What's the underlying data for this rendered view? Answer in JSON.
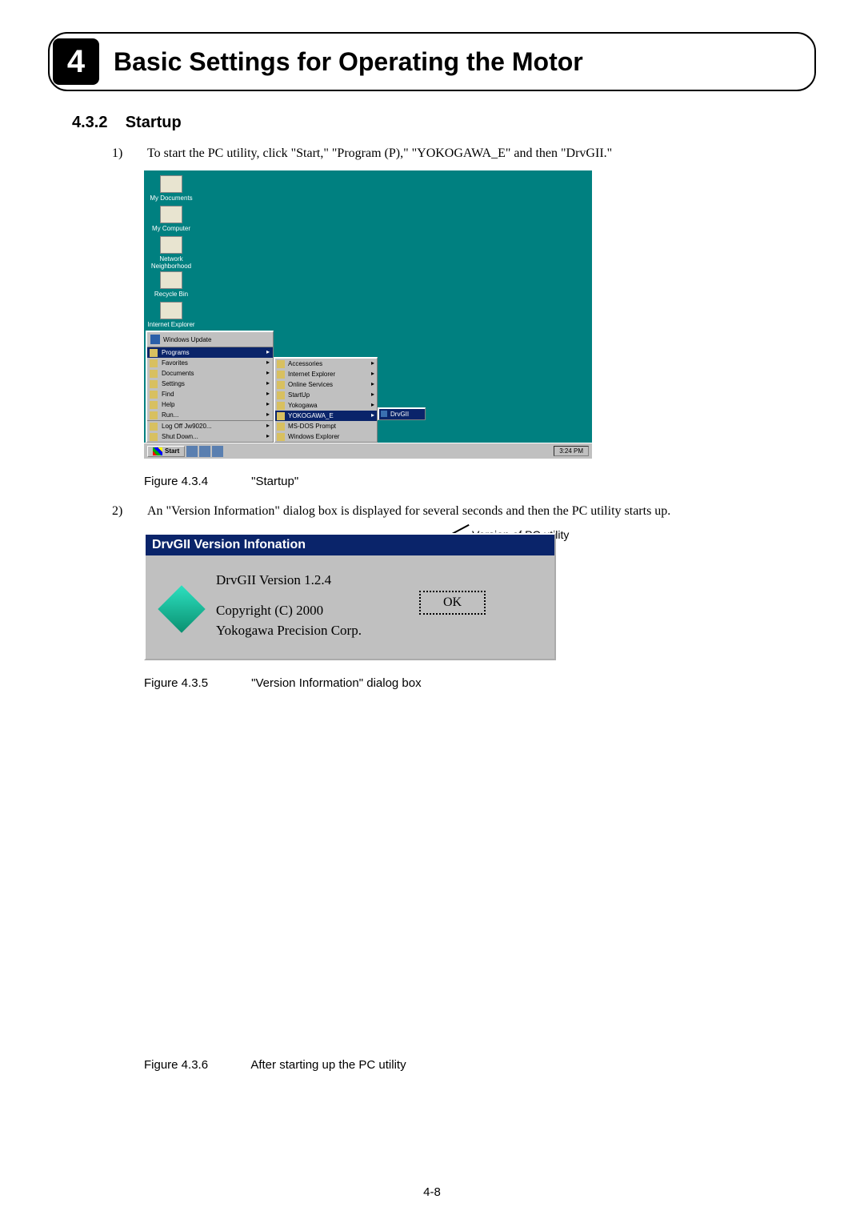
{
  "chapter": {
    "number": "4",
    "title": "Basic Settings for Operating the Motor"
  },
  "section": {
    "number": "4.3.2",
    "title": "Startup"
  },
  "steps": {
    "s1": {
      "num": "1)",
      "text": "To start the PC utility, click \"Start,\" \"Program (P),\" \"YOKOGAWA_E\" and then \"DrvGII.\""
    },
    "s2": {
      "num": "2)",
      "text": "An \"Version Information\" dialog box is displayed for several seconds and then the PC utility starts up."
    }
  },
  "desktop": {
    "icons": [
      "My Documents",
      "My Computer",
      "Network Neighborhood",
      "Recycle Bin",
      "Internet Explorer"
    ],
    "windows_update": "Windows Update",
    "start_menu": [
      "Programs",
      "Favorites",
      "Documents",
      "Settings",
      "Find",
      "Help",
      "Run...",
      "Log Off Jw9020...",
      "Shut Down..."
    ],
    "submenu": [
      "Accessories",
      "Internet Explorer",
      "Online Services",
      "StartUp",
      "Yokogawa",
      "YOKOGAWA_E",
      "MS-DOS Prompt",
      "Windows Explorer"
    ],
    "submenu2": "DrvGII",
    "taskbar": {
      "start": "Start",
      "time": "3:24 PM"
    }
  },
  "figures": {
    "f434": {
      "num": "Figure 4.3.4",
      "title": "\"Startup\""
    },
    "f435": {
      "num": "Figure 4.3.5",
      "title": "\"Version Information\" dialog box"
    },
    "f436": {
      "num": "Figure 4.3.6",
      "title": "After starting up the PC utility"
    }
  },
  "annotation": {
    "version_label": "Version of PC utility"
  },
  "dialog": {
    "title": "DrvGII Version Infonation",
    "line1": "DrvGII Version 1.2.4",
    "line2": "Copyright (C) 2000",
    "line3": "Yokogawa Precision Corp.",
    "ok": "OK"
  },
  "page_number": "4-8"
}
